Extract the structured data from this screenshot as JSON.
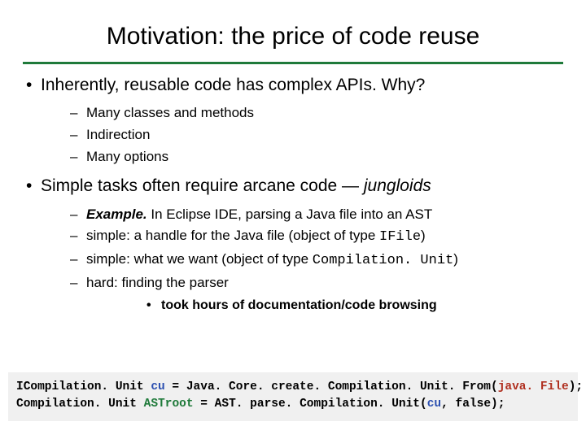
{
  "title": "Motivation: the price of code reuse",
  "b1": {
    "text": "Inherently, reusable code has complex APIs. Why?",
    "s1": "Many classes and methods",
    "s2": "Indirection",
    "s3": "Many options"
  },
  "b2": {
    "prefix": "Simple tasks often require arcane code — ",
    "term": "jungloids",
    "s1a": "Example.",
    "s1b": " In Eclipse IDE, parsing a Java file into an AST",
    "s2a": "simple: a handle for the Java file (object of type ",
    "s2b": "IFile",
    "s2c": ")",
    "s3a": "simple: what we want (object of type ",
    "s3b": "Compilation. Unit",
    "s3c": ")",
    "s4": "hard: finding the parser",
    "ss1": "took hours of documentation/code browsing"
  },
  "code": {
    "l1a": "ICompilation. Unit ",
    "l1b": "cu",
    "l1c": " = Java. Core. create. Compilation. Unit. From(",
    "l1d": "java. File",
    "l1e": ");",
    "l2a": "Compilation. Unit ",
    "l2b": "ASTroot",
    "l2c": " = AST. parse. Compilation. Unit(",
    "l2d": "cu",
    "l2e": ", false);"
  }
}
